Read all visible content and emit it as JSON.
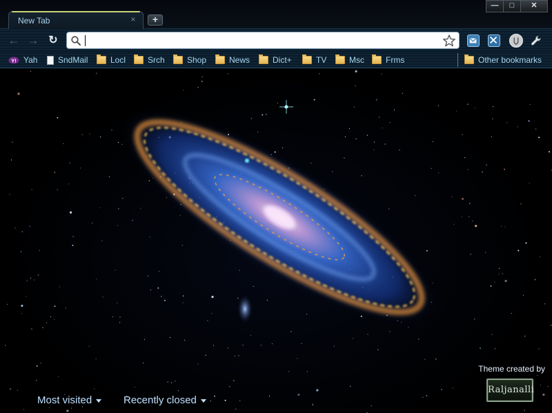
{
  "tab": {
    "title": "New Tab",
    "close": "×"
  },
  "window": {
    "new_tab": "+",
    "minimize": "—",
    "maximize": "□",
    "close": "✕"
  },
  "nav": {
    "back": "←",
    "forward": "→",
    "reload": "↻"
  },
  "omnibox": {
    "value": "",
    "placeholder": ""
  },
  "bookmarks": [
    {
      "label": "Yah",
      "icon": "yahoo-icon"
    },
    {
      "label": "SndMail",
      "icon": "page-icon"
    },
    {
      "label": "Locl",
      "icon": "folder-icon"
    },
    {
      "label": "Srch",
      "icon": "folder-icon"
    },
    {
      "label": "Shop",
      "icon": "folder-icon"
    },
    {
      "label": "News",
      "icon": "folder-icon"
    },
    {
      "label": "Dict+",
      "icon": "folder-icon"
    },
    {
      "label": "TV",
      "icon": "folder-icon"
    },
    {
      "label": "Msc",
      "icon": "folder-icon"
    },
    {
      "label": "Frms",
      "icon": "folder-icon"
    }
  ],
  "other_bookmarks": {
    "label": "Other bookmarks",
    "icon": "folder-icon"
  },
  "ntp": {
    "most_visited": "Most visited",
    "recently_closed": "Recently closed",
    "theme_credit": "Theme created by",
    "theme_author": "Raljanalli"
  },
  "colors": {
    "bookmark_text": "#a8d8f0",
    "ntp_link": "#bfe0ff",
    "frame_dark": "#0a1a28",
    "folder": "#e6b452"
  }
}
